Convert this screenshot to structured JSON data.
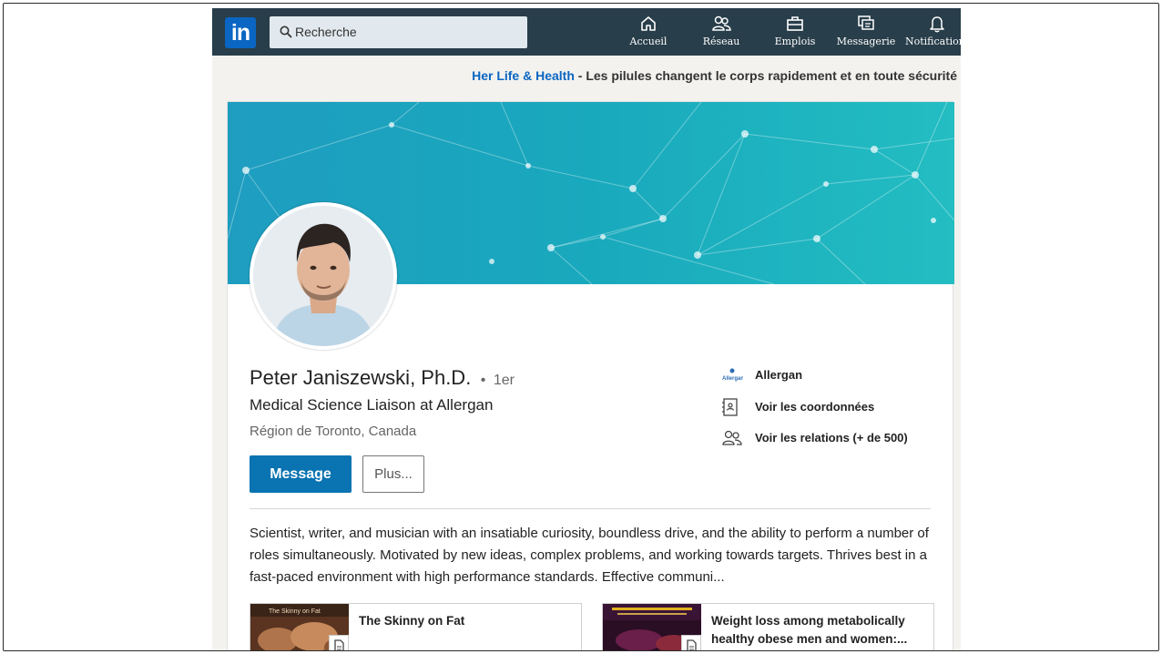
{
  "nav": {
    "logo_text": "in",
    "search_placeholder": "Recherche",
    "items": [
      {
        "label": "Accueil",
        "icon": "home-icon"
      },
      {
        "label": "Réseau",
        "icon": "network-icon"
      },
      {
        "label": "Emplois",
        "icon": "briefcase-icon"
      },
      {
        "label": "Messagerie",
        "icon": "messaging-icon"
      },
      {
        "label": "Notifications",
        "icon": "bell-icon"
      }
    ]
  },
  "ad": {
    "brand": "Her Life & Health",
    "text": " - Les pilules changent le corps rapidement et en toute sécurité"
  },
  "profile": {
    "name": "Peter Janiszewski, Ph.D.",
    "degree_separator": "•",
    "degree": "1er",
    "headline": "Medical Science Liaison at Allergan",
    "location": "Région de Toronto, Canada",
    "message_button": "Message",
    "more_button": "Plus...",
    "side": {
      "company": "Allergan",
      "contact": "Voir les coordonnées",
      "connections": "Voir les relations (+ de 500)"
    },
    "summary": "Scientist, writer, and musician with an insatiable curiosity, boundless drive, and the ability to perform a number of roles simultaneously. Motivated by new ideas, complex problems, and working towards targets. Thrives best in a fast-paced environment with high performance standards. Effective communi...",
    "media": [
      {
        "title": "The Skinny on Fat"
      },
      {
        "title": "Weight loss among metabolically healthy obese men and women:..."
      }
    ]
  },
  "colors": {
    "nav_bg": "#283e4a",
    "brand_blue": "#0a66c2",
    "message_button": "#0a73b1",
    "cover_start": "#1e9dc0",
    "cover_end": "#23bdc2"
  }
}
